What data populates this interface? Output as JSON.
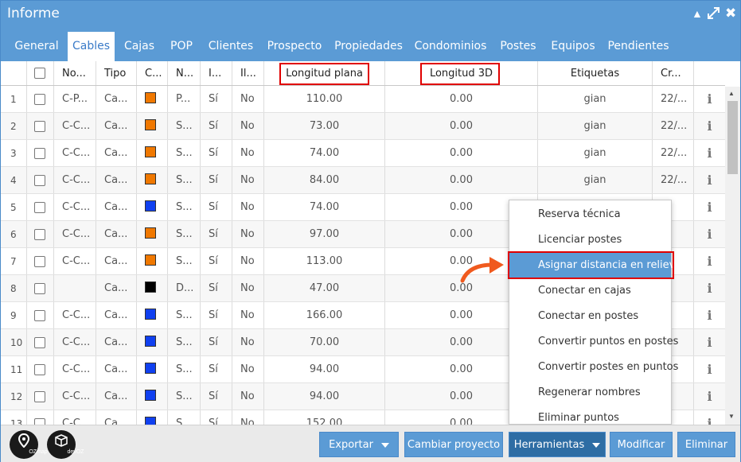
{
  "window": {
    "title": "Informe"
  },
  "tabs": [
    "General",
    "Cables",
    "Cajas",
    "POP",
    "Clientes",
    "Prospecto",
    "Propiedades",
    "Condominios",
    "Postes",
    "Equipos",
    "Pendientes"
  ],
  "columns": {
    "name": "No...",
    "type": "Tipo",
    "color": "C...",
    "n": "N...",
    "i": "I...",
    "il": "Il...",
    "flat_length": "Longitud plana",
    "length_3d": "Longitud 3D",
    "tags": "Etiquetas",
    "created": "Cr..."
  },
  "rows": [
    {
      "num": "1",
      "name": "C-P...",
      "type": "Ca...",
      "color": "#f07800",
      "n": "P...",
      "i": "Sí",
      "il": "No",
      "flat": "110.00",
      "len3d": "0.00",
      "tags": "gian",
      "created": "22/..."
    },
    {
      "num": "2",
      "name": "C-C...",
      "type": "Ca...",
      "color": "#f07800",
      "n": "S...",
      "i": "Sí",
      "il": "No",
      "flat": "73.00",
      "len3d": "0.00",
      "tags": "gian",
      "created": "22/..."
    },
    {
      "num": "3",
      "name": "C-C...",
      "type": "Ca...",
      "color": "#f07800",
      "n": "S...",
      "i": "Sí",
      "il": "No",
      "flat": "74.00",
      "len3d": "0.00",
      "tags": "gian",
      "created": "22/..."
    },
    {
      "num": "4",
      "name": "C-C...",
      "type": "Ca...",
      "color": "#f07800",
      "n": "S...",
      "i": "Sí",
      "il": "No",
      "flat": "84.00",
      "len3d": "0.00",
      "tags": "gian",
      "created": "22/..."
    },
    {
      "num": "5",
      "name": "C-C...",
      "type": "Ca...",
      "color": "#1040f0",
      "n": "S...",
      "i": "Sí",
      "il": "No",
      "flat": "74.00",
      "len3d": "0.00",
      "tags": "",
      "created": ""
    },
    {
      "num": "6",
      "name": "C-C...",
      "type": "Ca...",
      "color": "#f07800",
      "n": "S...",
      "i": "Sí",
      "il": "No",
      "flat": "97.00",
      "len3d": "0.00",
      "tags": "",
      "created": ""
    },
    {
      "num": "7",
      "name": "C-C...",
      "type": "Ca...",
      "color": "#f07800",
      "n": "S...",
      "i": "Sí",
      "il": "No",
      "flat": "113.00",
      "len3d": "0.00",
      "tags": "",
      "created": ""
    },
    {
      "num": "8",
      "name": "",
      "type": "Ca...",
      "color": "#000000",
      "n": "D...",
      "i": "Sí",
      "il": "No",
      "flat": "47.00",
      "len3d": "0.00",
      "tags": "",
      "created": ""
    },
    {
      "num": "9",
      "name": "C-C...",
      "type": "Ca...",
      "color": "#1040f0",
      "n": "S...",
      "i": "Sí",
      "il": "No",
      "flat": "166.00",
      "len3d": "0.00",
      "tags": "",
      "created": ""
    },
    {
      "num": "10",
      "name": "C-C...",
      "type": "Ca...",
      "color": "#1040f0",
      "n": "S...",
      "i": "Sí",
      "il": "No",
      "flat": "70.00",
      "len3d": "0.00",
      "tags": "",
      "created": ""
    },
    {
      "num": "11",
      "name": "C-C...",
      "type": "Ca...",
      "color": "#1040f0",
      "n": "S...",
      "i": "Sí",
      "il": "No",
      "flat": "94.00",
      "len3d": "0.00",
      "tags": "",
      "created": ""
    },
    {
      "num": "12",
      "name": "C-C...",
      "type": "Ca...",
      "color": "#1040f0",
      "n": "S...",
      "i": "Sí",
      "il": "No",
      "flat": "94.00",
      "len3d": "0.00",
      "tags": "",
      "created": ""
    },
    {
      "num": "13",
      "name": "C-C...",
      "type": "Ca...",
      "color": "#1040f0",
      "n": "S...",
      "i": "Sí",
      "il": "No",
      "flat": "152.00",
      "len3d": "0.00",
      "tags": "",
      "created": ""
    }
  ],
  "menu": {
    "items": [
      "Reserva técnica",
      "Licenciar postes",
      "Asignar distancia en relieve",
      "Conectar en cajas",
      "Conectar en postes",
      "Convertir puntos en postes",
      "Convertir postes en puntos",
      "Regenerar nombres",
      "Eliminar puntos"
    ]
  },
  "footer": {
    "export": "Exportar",
    "change_project": "Cambiar proyecto",
    "tools": "Herramientas",
    "modify": "Modificar",
    "delete": "Eliminar",
    "logo1": "OZmap",
    "logo2": "devOZ"
  },
  "colors": {
    "header_blue": "#5b9bd5",
    "highlight": "#5b9bd5",
    "annotation_red": "#e00000",
    "arrow_orange": "#f05a1e"
  },
  "icons": [
    "up-icon",
    "expand-icon",
    "close-icon",
    "info-icon",
    "caret-down-icon",
    "pin-icon",
    "box-icon"
  ]
}
